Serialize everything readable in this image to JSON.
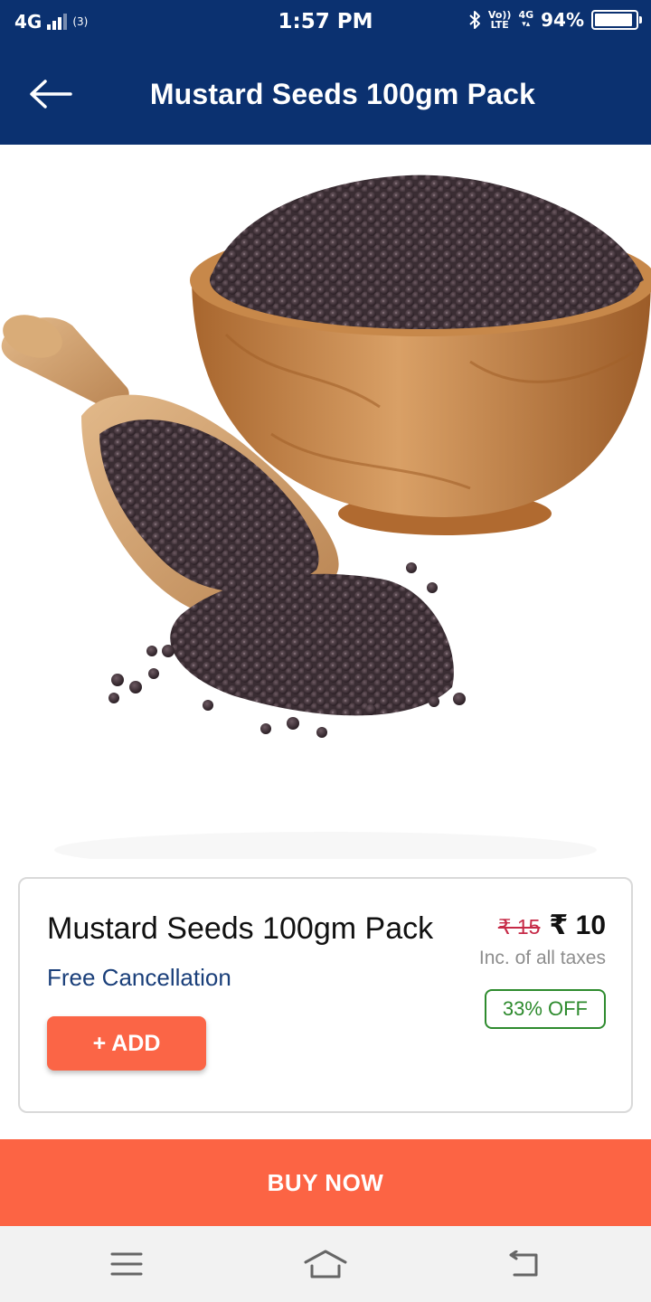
{
  "status_bar": {
    "network_left": "4G",
    "hotspot_label": "(3)",
    "time": "1:57 PM",
    "volte_top": "Vo))",
    "volte_bottom": "LTE",
    "network_right": "4G",
    "battery_percent_text": "94%",
    "battery_level": 0.94
  },
  "header": {
    "title": "Mustard Seeds 100gm Pack",
    "back_icon": "arrow-left-icon"
  },
  "product_image": {
    "alt": "Mustard seeds in wooden bowl and scoop"
  },
  "product": {
    "name": "Mustard Seeds 100gm Pack",
    "free_cancellation": "Free Cancellation",
    "mrp": "₹ 15",
    "price": "₹ 10",
    "tax_note": "Inc. of all taxes",
    "discount_badge": "33% OFF",
    "add_label": "+ ADD"
  },
  "footer": {
    "buy_now_label": "BUY NOW"
  },
  "nav_bar": {
    "icons": [
      "menu-icon",
      "home-icon",
      "back-icon"
    ]
  },
  "colors": {
    "header_bg": "#0b3170",
    "accent_orange": "#fb6546",
    "discount_green": "#2e8b2e",
    "mrp_red": "#c62a47",
    "link_blue": "#1a3f7a"
  }
}
